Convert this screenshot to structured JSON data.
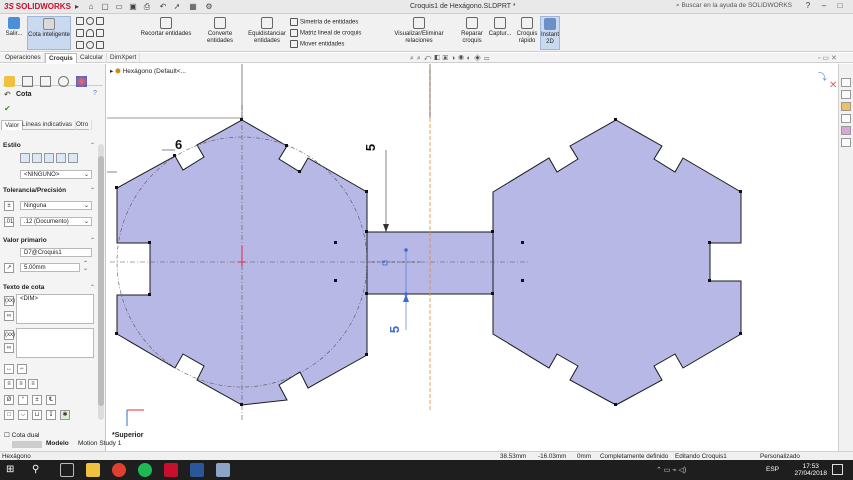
{
  "titlebar": {
    "logo_prefix": "3S",
    "logo": "SOLIDWORKS",
    "document_title": "Croquis1 de Hexágono.SLDPRT *",
    "help_placeholder": "Buscar en la ayuda de SOLIDWORKS",
    "window_controls": [
      "?",
      "–",
      "□",
      "×"
    ]
  },
  "ribbon": {
    "exit_sketch": "Salir...",
    "smart_dimension": "Cota inteligente",
    "trim": "Recortar entidades",
    "convert": "Converte entidades",
    "offset": "Equidistanciar entidades",
    "mirror": "Simetría de entidades",
    "linear_pattern": "Matriz lineal de croquis",
    "move": "Mover entidades",
    "relations": "Visualizar/Eliminar relaciones",
    "repair": "Reparar croquis",
    "capture": "Captur...",
    "rapid_sketch": "Croquis rápido",
    "instant2d": "Instant 2D"
  },
  "tabs": [
    "Operaciones",
    "Croquis",
    "Calcular",
    "DimXpert"
  ],
  "active_tab": "Croquis",
  "panel": {
    "title": "Cota",
    "subtabs": [
      "Valor",
      "Líneas indicativas",
      "Otro"
    ],
    "style_title": "Estilo",
    "style_value": "<NINGUNO>",
    "tolerance_title": "Tolerancia/Precisión",
    "tolerance_type": "Ninguna",
    "precision": ".12 (Documento)",
    "primary_title": "Valor primario",
    "primary_name": "D7@Croquis1",
    "primary_value": "5.00mm",
    "dimtext_title": "Texto de cota",
    "dimtext_value": "<DIM>",
    "dual_label": "Cota dual"
  },
  "tree": {
    "part_name": "Hexágono",
    "part_suffix": " (Default<..."
  },
  "graphics": {
    "dim_6": "6",
    "dim_5_top": "5",
    "dim_5_bottom": "5",
    "view_label": "*Superior"
  },
  "bottom_tabs": [
    "Modelo",
    "Motion Study 1"
  ],
  "status": {
    "part": "Hexágono",
    "x": "38.53mm",
    "y": "-16.03mm",
    "z": "0mm",
    "state": "Completamente definido",
    "editing": "Editando Croquis1",
    "units": "Personalizado"
  },
  "taskbar": {
    "lang": "ESP",
    "time": "17:53",
    "date": "27/04/2018"
  },
  "colors": {
    "shape_fill": "#b7b8e6",
    "shape_stroke": "#1a1a1a",
    "centerline": "#555555",
    "dim_blue": "#3a6bd6",
    "origin_red": "#e03030",
    "sym_orange": "#e88a2a"
  }
}
